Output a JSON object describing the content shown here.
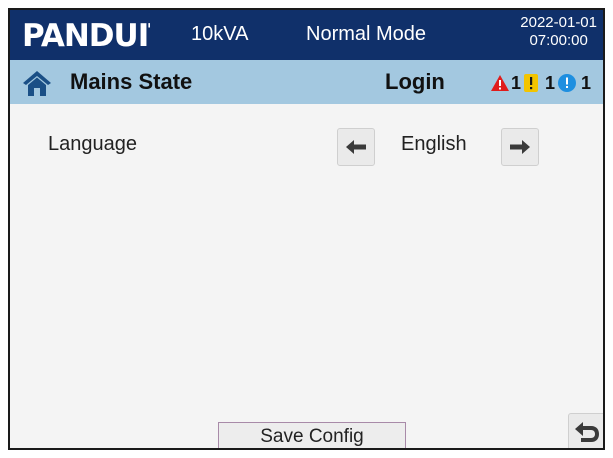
{
  "header": {
    "logo_text": "PANDUIT",
    "model": "10kVA",
    "mode": "Normal Mode",
    "date": "2022-01-01",
    "time": "07:00:00",
    "bg_color": "#10306a"
  },
  "status_bar": {
    "home_icon": "home-icon",
    "title": "Mains State",
    "login_label": "Login",
    "alarms": {
      "critical_count": "1",
      "warning_count": "1",
      "info_count": "1",
      "critical_color": "#e01b1b",
      "warning_color": "#f2c400",
      "info_color": "#1e8fe0"
    },
    "bg_color": "#a3c8e0"
  },
  "settings": {
    "language_label": "Language",
    "language_value": "English",
    "prev_icon": "arrow-left-icon",
    "next_icon": "arrow-right-icon"
  },
  "footer": {
    "save_label": "Save Config",
    "back_icon": "back-icon"
  }
}
